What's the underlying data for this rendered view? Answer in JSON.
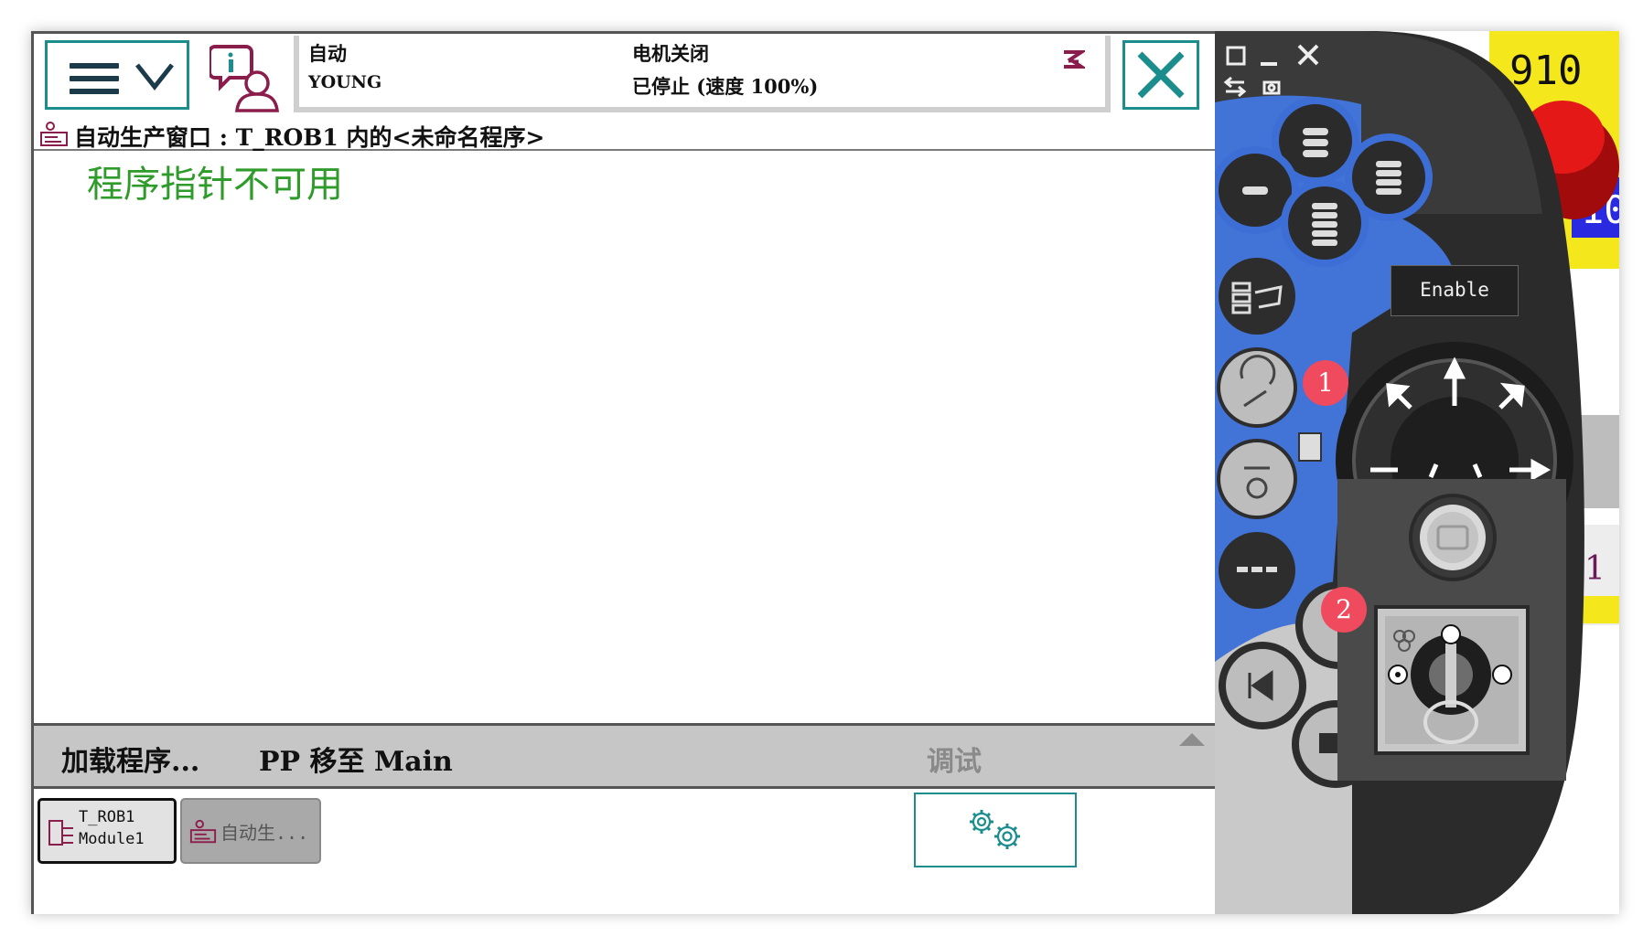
{
  "status": {
    "mode": "自动",
    "controller_name": "YOUNG",
    "motor_state": "电机关闭",
    "run_state": "已停止 (速度 100%)"
  },
  "window": {
    "title": "自动生产窗口 : T_ROB1 内的<未命名程序>",
    "message": "程序指针不可用"
  },
  "commands": {
    "load_program": "加载程序...",
    "pp_to_main": "PP 移至 Main",
    "debug": "调试"
  },
  "taskbar": {
    "task1_line1": "T_ROB1",
    "task1_line2": "Module1",
    "task2_label": "自动生..."
  },
  "device": {
    "enable_label": "Enable",
    "badge_1": "1",
    "badge_2": "2",
    "edge_fragment_1": "910",
    "edge_fragment_2": "10",
    "edge_fragment_3": "1"
  },
  "colors": {
    "accent_teal": "#1a8d8c",
    "message_green": "#2e9b2a",
    "command_bar": "#c6c6c6",
    "pendant_blue": "#3f6fd0",
    "badge_red": "#ef4a5d",
    "estop_red": "#d81414",
    "estop_yellow": "#f4e81c"
  }
}
